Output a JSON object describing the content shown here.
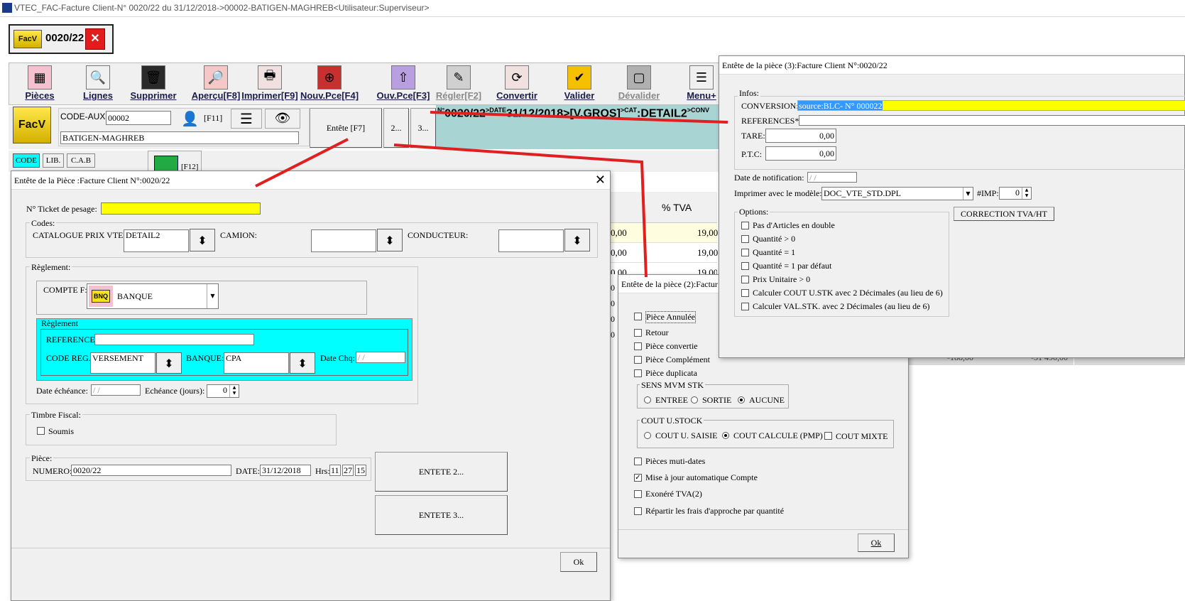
{
  "window": {
    "title": "VTEC_FAC-Facture Client-N° 0020/22 du 31/12/2018->00002-BATIGEN-MAGHREB<Utilisateur:Superviseur>"
  },
  "doc_tab": {
    "badge": "FacV",
    "number": "0020/22",
    "close": "✕"
  },
  "toolbar": {
    "items": [
      {
        "label": "Pièces",
        "icon": "pieces-icon",
        "glyph": "▦",
        "color": "#f5c0d0",
        "enabled": true
      },
      {
        "label": "Lignes",
        "icon": "magnifier-icon",
        "glyph": "🔍",
        "color": "#f0f0f0",
        "enabled": true
      },
      {
        "label": "Supprimer",
        "icon": "trash-icon",
        "glyph": "🗑",
        "color": "#2a2a2a",
        "enabled": true
      },
      {
        "label": "Aperçu[F8]",
        "icon": "preview-icon",
        "glyph": "🔎",
        "color": "#f5c8c8",
        "enabled": true
      },
      {
        "label": "Imprimer[F9]",
        "icon": "printer-icon",
        "glyph": "🖶",
        "color": "#f0e0e0",
        "enabled": true
      },
      {
        "label": "Nouv.Pce[F4]",
        "icon": "new-piece-icon",
        "glyph": "⊕",
        "color": "#c83030",
        "enabled": true
      },
      {
        "label": "Ouv.Pce[F3]",
        "icon": "open-piece-icon",
        "glyph": "⇧",
        "color": "#b8a0e0",
        "enabled": true
      },
      {
        "label": "Régler[F2]",
        "icon": "settle-icon",
        "glyph": "✎",
        "color": "#d0d0d0",
        "enabled": false
      },
      {
        "label": "Convertir",
        "icon": "convert-icon",
        "glyph": "⟳",
        "color": "#f0e0e0",
        "enabled": true
      },
      {
        "label": "Valider",
        "icon": "validate-icon",
        "glyph": "✔",
        "color": "#f5c000",
        "enabled": true
      },
      {
        "label": "Dévalider",
        "icon": "unvalidate-icon",
        "glyph": "▢",
        "color": "#b0b0b0",
        "enabled": false
      },
      {
        "label": "Menu+",
        "icon": "menu-icon",
        "glyph": "☰",
        "color": "#f0f0f0",
        "enabled": true
      }
    ]
  },
  "header": {
    "code_aux_label": "CODE-AUX:",
    "code_aux_value": "00002",
    "f11": "[F11]",
    "client_name": "BATIGEN-MAGHREB",
    "entete_btn": "Entête [F7]",
    "btn2": "2...",
    "btn3": "3...",
    "info_no_lbl": "N°",
    "info_no": "0020/22",
    "info_date_lbl": ">DATE",
    "info_date": "31/12/2018",
    "info_vgros": ">[V.GROS]",
    "info_cat_lbl": ">CAT",
    "info_cat": ":DETAIL2",
    "info_conv": ">CONV"
  },
  "filter_tabs": [
    "CODE",
    "LIB.",
    "C.A.B"
  ],
  "f12": "[F12]",
  "grid": {
    "col_tva": "% TVA",
    "rows": [
      [
        "0,00",
        "19,00"
      ],
      [
        "0,00",
        "19,00"
      ],
      [
        "0,00",
        "19,00"
      ]
    ],
    "partial_chars": [
      "0",
      "0",
      "0",
      "0",
      "0"
    ],
    "totals": [
      "-188,00",
      "-31 490,00"
    ]
  },
  "dialog1": {
    "title": "Entête de la Pièce :Facture Client N°:0020/22",
    "ticket_label": "N° Ticket de pesage:",
    "ticket_value": "",
    "codes_title": "Codes:",
    "catalogue_label": "CATALOGUE PRIX VTE:",
    "catalogue_value": "DETAIL2",
    "camion_label": "CAMION:",
    "camion_value": "",
    "conducteur_label": "CONDUCTEUR:",
    "conducteur_value": "",
    "reglement_title": "Règlement:",
    "compte_label": "COMPTE F:",
    "compte_badge": "BNQ",
    "compte_value": "BANQUE",
    "reglement_inner_title": "Règlement",
    "reference_label": "REFERENCE:",
    "reference_value": "",
    "code_reg_label": "CODE REG.:",
    "code_reg_value": "VERSEMENT",
    "banque_label": "BANQUE:",
    "banque_value": "CPA",
    "date_chq_label": "Date Chq:",
    "date_chq_value": " / /",
    "date_ech_label": "Date échéance:",
    "date_ech_value": " / /",
    "echeance_label": "Echéance (jours):",
    "echeance_value": "0",
    "timbre_title": "Timbre Fiscal:",
    "soumis_label": "Soumis",
    "piece_title": "Pièce:",
    "numero_label": "NUMERO:",
    "numero_value": "0020/22",
    "date_label": "DATE:",
    "date_value": "31/12/2018",
    "hrs_label": "Hrs:",
    "hh": "11",
    "mm": "27",
    "ss": "15",
    "entete2_btn": "ENTETE 2...",
    "entete3_btn": "ENTETE 3...",
    "ok_btn": "Ok"
  },
  "dialog2": {
    "title": "Entête de la pièce (2):Factur",
    "checks": [
      {
        "label": "Pièce Annulée",
        "checked": false
      },
      {
        "label": "Retour",
        "checked": false
      },
      {
        "label": "Pièce convertie",
        "checked": false
      },
      {
        "label": "Pièce Complément",
        "checked": false
      },
      {
        "label": "Pièce duplicata",
        "checked": false
      }
    ],
    "sens_title": "SENS MVM STK",
    "sens_options": [
      "ENTREE",
      "SORTIE",
      "AUCUNE"
    ],
    "sens_selected": "AUCUNE",
    "cout_title": "COUT U.STOCK",
    "cout_options": [
      "COUT U. SAISIE",
      "COUT CALCULE (PMP)"
    ],
    "cout_selected": "COUT CALCULE (PMP)",
    "cout_mixte": "COUT MIXTE",
    "checks2": [
      {
        "label": "Pièces muti-dates",
        "checked": false
      },
      {
        "label": "Mise à jour automatique Compte",
        "checked": true
      },
      {
        "label": "Exonéré TVA(2)",
        "checked": false
      },
      {
        "label": "Répartir les frais d'approche par quantité",
        "checked": false
      }
    ],
    "ok_btn": "Ok"
  },
  "dialog3": {
    "title": "Entête de la pièce (3):Facture Client N°:0020/22",
    "infos_title": "Infos:",
    "conversion_label": "CONVERSION:",
    "conversion_value": "source:BLC- N° 000022",
    "references_label": "REFERENCES*:",
    "references_value": "",
    "tare_label": "TARE:",
    "tare_value": "0,00",
    "ptc_label": "P.T.C:",
    "ptc_value": "0,00",
    "date_notif_label": "Date de notification:",
    "date_notif_value": " / /",
    "modele_label": "Imprimer avec le modèle:",
    "modele_value": "DOC_VTE_STD.DPL",
    "imp_label": "#IMP:",
    "imp_value": "0",
    "options_title": "Options:",
    "correction_btn": "CORRECTION TVA/HT",
    "options": [
      "Pas d'Articles en double",
      "Quantité > 0",
      "Quantité = 1",
      "Quantité = 1 par défaut",
      "Prix Unitaire > 0",
      "Calculer COUT U.STK avec 2 Décimales (au lieu de 6)",
      "Calculer VAL.STK. avec 2 Décimales (au lieu de 6)"
    ]
  },
  "colors": {
    "yellow": "#ffff00",
    "cyan": "#00ffff",
    "selection": "#3399ff",
    "teal": "#a8d4d4",
    "red": "#e02020"
  }
}
